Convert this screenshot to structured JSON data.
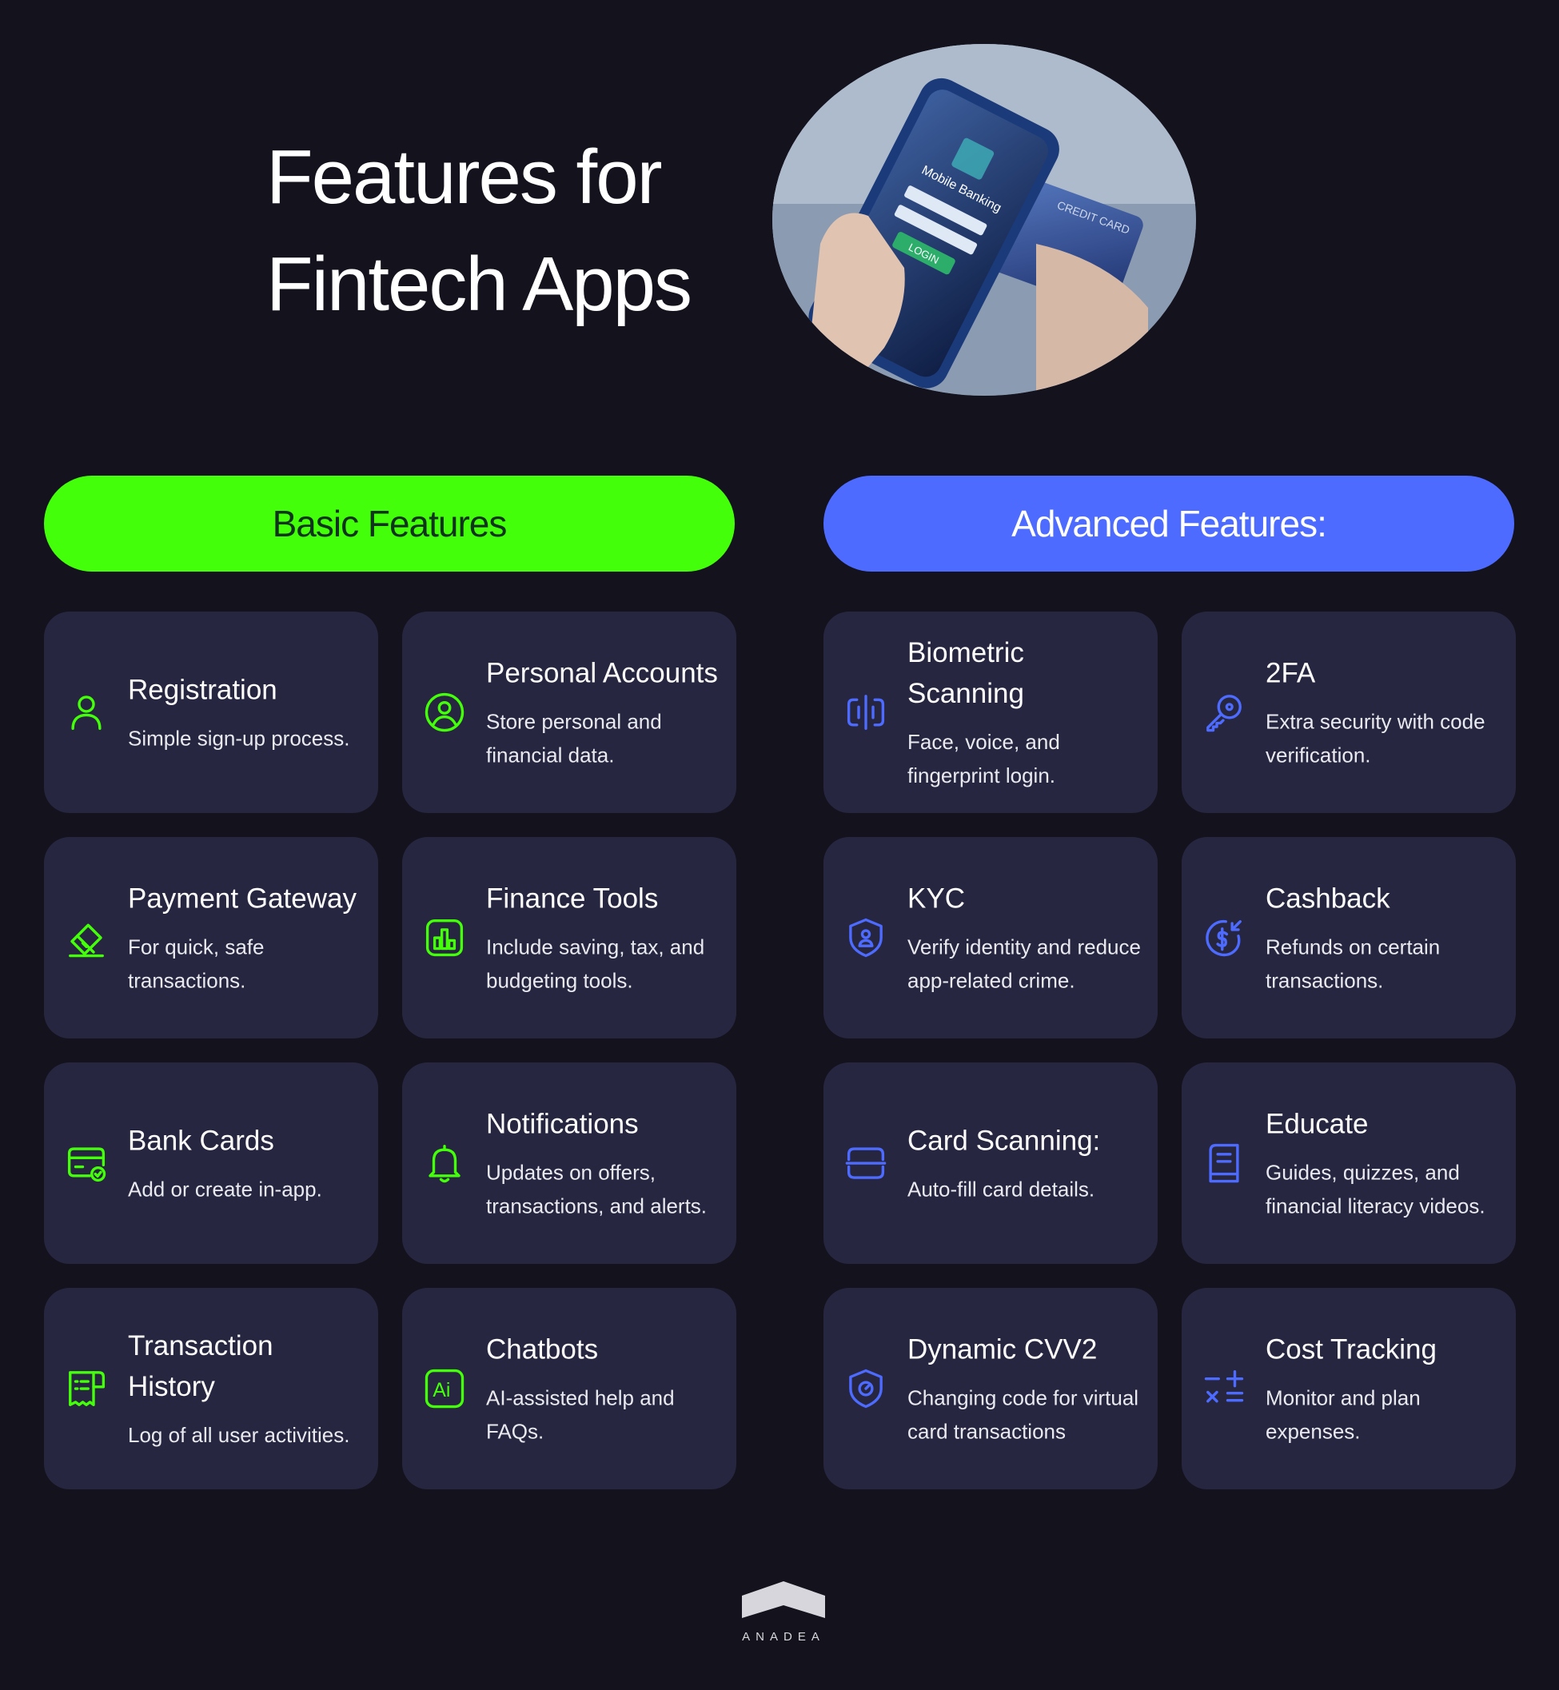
{
  "title_line1": "Features for",
  "title_line2": "Fintech Apps",
  "hero_image": {
    "phone_header": "Mobile Banking",
    "phone_button": "LOGIN",
    "card_label": "CREDIT CARD"
  },
  "colors": {
    "background": "#13121d",
    "card": "#272640",
    "basic_accent": "#44ff0a",
    "advanced_accent": "#4d6bff"
  },
  "basic": {
    "heading": "Basic Features",
    "items": [
      {
        "icon": "user-icon",
        "title": "Registration",
        "desc": "Simple sign-up process."
      },
      {
        "icon": "user-circle-icon",
        "title": "Personal Accounts",
        "desc": "Store personal and financial data."
      },
      {
        "icon": "payment-card-icon",
        "title": "Payment Gateway",
        "desc": "For quick, safe transactions."
      },
      {
        "icon": "bar-chart-icon",
        "title": "Finance Tools",
        "desc": "Include saving, tax, and budgeting tools."
      },
      {
        "icon": "card-check-icon",
        "title": "Bank Cards",
        "desc": "Add or create in-app."
      },
      {
        "icon": "bell-icon",
        "title": "Notifications",
        "desc": "Updates on offers, transactions, and alerts."
      },
      {
        "icon": "receipt-icon",
        "title": "Transaction History",
        "desc": "Log of all user activities."
      },
      {
        "icon": "ai-icon",
        "title": "Chatbots",
        "desc": "AI-assisted help and FAQs."
      }
    ]
  },
  "advanced": {
    "heading": "Advanced Features:",
    "items": [
      {
        "icon": "biometric-icon",
        "title": "Biometric Scanning",
        "desc": "Face, voice, and fingerprint login."
      },
      {
        "icon": "key-icon",
        "title": "2FA",
        "desc": "Extra security with code verification."
      },
      {
        "icon": "shield-user-icon",
        "title": "KYC",
        "desc": "Verify identity and reduce app-related crime."
      },
      {
        "icon": "cashback-icon",
        "title": "Cashback",
        "desc": "Refunds on certain transactions."
      },
      {
        "icon": "card-scan-icon",
        "title": "Card Scanning:",
        "desc": "Auto-fill card details."
      },
      {
        "icon": "book-icon",
        "title": "Educate",
        "desc": "Guides, quizzes, and financial literacy videos."
      },
      {
        "icon": "shield-lock-icon",
        "title": "Dynamic CVV2",
        "desc": "Changing code for virtual card transactions"
      },
      {
        "icon": "calculator-icon",
        "title": "Cost Tracking",
        "desc": "Monitor and plan expenses."
      }
    ]
  },
  "footer": {
    "brand": "ANADEA"
  }
}
